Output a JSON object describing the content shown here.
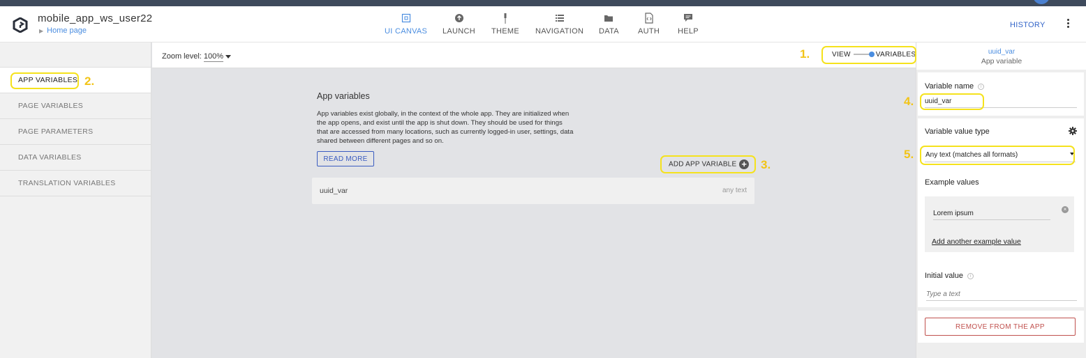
{
  "header": {
    "app_name": "mobile_app_ws_user22",
    "breadcrumb": "Home page",
    "nav": [
      {
        "label": "UI CANVAS",
        "icon": "canvas-icon"
      },
      {
        "label": "LAUNCH",
        "icon": "upload-icon"
      },
      {
        "label": "THEME",
        "icon": "brush-icon"
      },
      {
        "label": "NAVIGATION",
        "icon": "list-icon"
      },
      {
        "label": "DATA",
        "icon": "folder-icon"
      },
      {
        "label": "AUTH",
        "icon": "document-code-icon"
      },
      {
        "label": "HELP",
        "icon": "chat-icon"
      }
    ],
    "history": "HISTORY",
    "accent": "#4a8de0"
  },
  "sidebar": {
    "items": [
      {
        "label": "APP VARIABLES"
      },
      {
        "label": "PAGE VARIABLES"
      },
      {
        "label": "PAGE PARAMETERS"
      },
      {
        "label": "DATA VARIABLES"
      },
      {
        "label": "TRANSLATION VARIABLES"
      }
    ]
  },
  "toolbar": {
    "zoom_label": "Zoom level:",
    "zoom_value": "100%",
    "view_label": "VIEW",
    "variables_label": "VARIABLES"
  },
  "canvas": {
    "title": "App variables",
    "description": "App variables exist globally, in the context of the whole app. They are initialized when the app opens, and exist until the app is shut down. They should be used for things that are accessed from many locations, such as currently logged-in user, settings, data shared between different pages and so on.",
    "read_more": "READ MORE",
    "add_variable": "ADD APP VARIABLE",
    "variables": [
      {
        "name": "uuid_var",
        "type": "any text"
      }
    ]
  },
  "right_panel": {
    "variable_id": "uuid_var",
    "subtitle": "App variable",
    "variable_name_label": "Variable name",
    "variable_name_value": "uuid_var",
    "value_type_label": "Variable value type",
    "value_type_selected": "Any text (matches all formats)",
    "example_values_label": "Example values",
    "example_value": "Lorem ipsum",
    "add_example": "Add another example value",
    "initial_value_label": "Initial value",
    "initial_value_placeholder": "Type a text",
    "remove_button": "REMOVE FROM THE APP"
  },
  "annotations": {
    "color": "#f5e21c",
    "numbers": [
      "1.",
      "2.",
      "3.",
      "4.",
      "5."
    ]
  }
}
